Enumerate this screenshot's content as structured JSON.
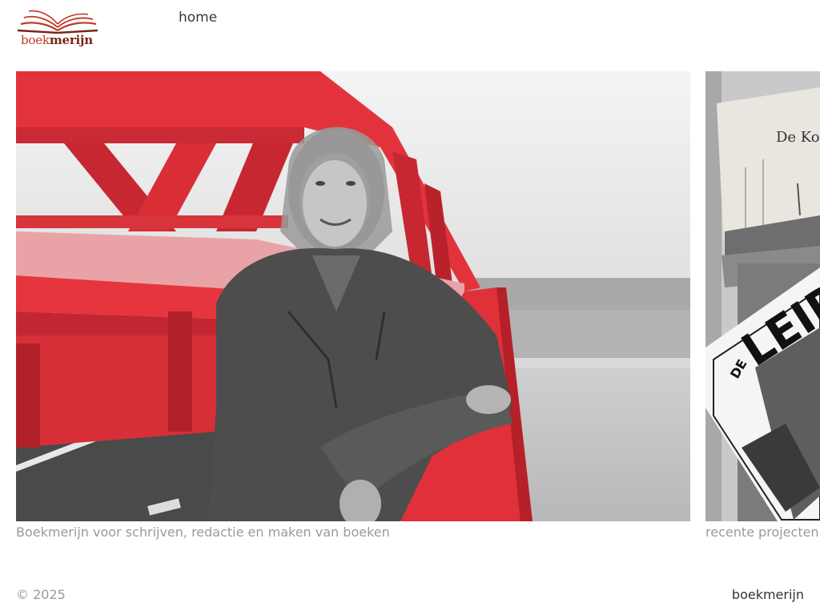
{
  "header": {
    "logo": {
      "text_part1": "boek",
      "text_part2": "merijn",
      "icon": "open-book-icon"
    },
    "nav": [
      {
        "label": "home"
      }
    ]
  },
  "cards": [
    {
      "caption": "Boekmerijn voor schrijven, redactie en maken van boeken",
      "image": "woman-on-red-bridge-photo"
    },
    {
      "caption": "recente projecten",
      "image": "books-stack-photo",
      "visible_text": [
        "De Ko",
        "DE",
        "LEID"
      ]
    }
  ],
  "footer": {
    "copyright": "© 2025",
    "site": "boekmerijn"
  },
  "colors": {
    "brand_red": "#c0392b",
    "brand_dark": "#7a2418",
    "caption_gray": "#9a9a9a",
    "bridge_red": "#e0303a"
  }
}
